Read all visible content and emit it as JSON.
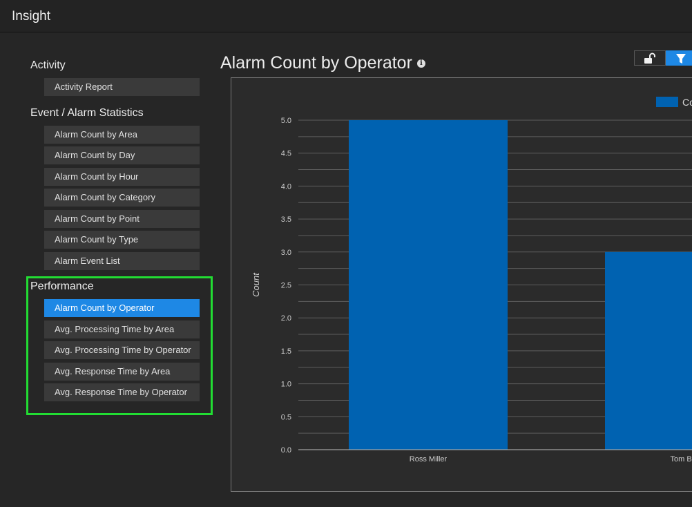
{
  "app": {
    "title": "Insight"
  },
  "sidebar": {
    "sections": [
      {
        "heading": "Activity",
        "items": [
          {
            "label": "Activity Report",
            "active": false
          }
        ]
      },
      {
        "heading": "Event / Alarm Statistics",
        "items": [
          {
            "label": "Alarm Count by Area"
          },
          {
            "label": "Alarm Count by Day"
          },
          {
            "label": "Alarm Count by Hour"
          },
          {
            "label": "Alarm Count by Category"
          },
          {
            "label": "Alarm Count by Point"
          },
          {
            "label": "Alarm Count by Type"
          },
          {
            "label": "Alarm Event List"
          }
        ]
      },
      {
        "heading": "Performance",
        "items": [
          {
            "label": "Alarm Count by Operator",
            "active": true
          },
          {
            "label": "Avg. Processing Time by Area"
          },
          {
            "label": "Avg. Processing Time by Operator"
          },
          {
            "label": "Avg. Response Time by Area"
          },
          {
            "label": "Avg. Response Time by Operator"
          }
        ]
      }
    ]
  },
  "main": {
    "title": "Alarm Count by Operator",
    "info_icon": "info-icon",
    "toolbar": {
      "lock_icon": "unlock-icon",
      "filter_icon": "filter-icon"
    }
  },
  "colors": {
    "accent": "#1e88e5",
    "bar": "#0062b1",
    "highlight": "#22dd33"
  },
  "chart_data": {
    "type": "bar",
    "categories": [
      "Ross Miller",
      "Tom Bra"
    ],
    "series": [
      {
        "name": "Co",
        "values": [
          5,
          3
        ]
      }
    ],
    "ylabel": "Count",
    "ylim": [
      0,
      5
    ],
    "yticks": [
      "0.0",
      "0.5",
      "1.0",
      "1.5",
      "2.0",
      "2.5",
      "3.0",
      "3.5",
      "4.0",
      "4.5",
      "5.0"
    ],
    "grid": true,
    "legend": "top-right"
  }
}
